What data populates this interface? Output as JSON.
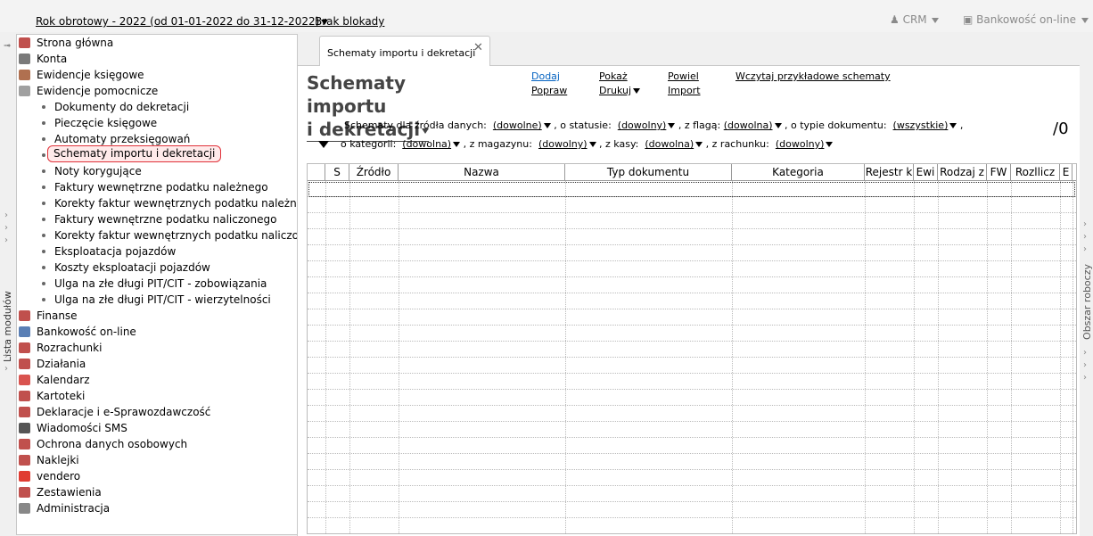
{
  "topbar": {
    "fiscal_year": "Rok obrotowy - 2022  (od 01-01-2022 do 31-12-2022)",
    "lock_status": "Brak blokady",
    "crm": "CRM",
    "online_banking": "Bankowość on-line"
  },
  "left_rail": {
    "label": "Lista modułów"
  },
  "right_rail": {
    "label": "Obszar roboczy"
  },
  "nav": {
    "items": [
      {
        "label": "Strona główna",
        "level": 0,
        "icon": "home-icon",
        "color": "#c0504d"
      },
      {
        "label": "Konta",
        "level": 0,
        "icon": "accounts-icon",
        "color": "#7a7a7a"
      },
      {
        "label": "Ewidencje księgowe",
        "level": 0,
        "icon": "ledger-icon",
        "color": "#b07050"
      },
      {
        "label": "Ewidencje pomocnicze",
        "level": 0,
        "icon": "auxiliary-ledger-icon",
        "color": "#a0a0a0"
      },
      {
        "label": "Dokumenty do dekretacji",
        "level": 1
      },
      {
        "label": "Pieczęcie księgowe",
        "level": 1
      },
      {
        "label": "Automaty przeksięgowań",
        "level": 1
      },
      {
        "label": "Schematy importu i dekretacji",
        "level": 1,
        "selected": true
      },
      {
        "label": "Noty korygujące",
        "level": 1
      },
      {
        "label": "Faktury wewnętrzne podatku należnego",
        "level": 1
      },
      {
        "label": "Korekty faktur wewnętrznych podatku należnego",
        "level": 1
      },
      {
        "label": "Faktury wewnętrzne podatku naliczonego",
        "level": 1
      },
      {
        "label": "Korekty faktur wewnętrznych podatku naliczonego",
        "level": 1
      },
      {
        "label": "Eksploatacja pojazdów",
        "level": 1
      },
      {
        "label": "Koszty eksploatacji pojazdów",
        "level": 1
      },
      {
        "label": "Ulga na złe długi PIT/CIT - zobowiązania",
        "level": 1
      },
      {
        "label": "Ulga na złe długi PIT/CIT - wierzytelności",
        "level": 1
      },
      {
        "label": "Finanse",
        "level": 0,
        "icon": "finance-icon",
        "color": "#c0504d"
      },
      {
        "label": "Bankowość on-line",
        "level": 0,
        "icon": "bank-icon",
        "color": "#5a7fb5"
      },
      {
        "label": "Rozrachunki",
        "level": 0,
        "icon": "settlements-icon",
        "color": "#c0504d"
      },
      {
        "label": "Działania",
        "level": 0,
        "icon": "actions-icon",
        "color": "#c0504d"
      },
      {
        "label": "Kalendarz",
        "level": 0,
        "icon": "calendar-icon",
        "color": "#d9534f"
      },
      {
        "label": "Kartoteki",
        "level": 0,
        "icon": "records-icon",
        "color": "#c0504d"
      },
      {
        "label": "Deklaracje i e-Sprawozdawczość",
        "level": 0,
        "icon": "declarations-icon",
        "color": "#c0504d"
      },
      {
        "label": "Wiadomości SMS",
        "level": 0,
        "icon": "sms-icon",
        "color": "#555555"
      },
      {
        "label": "Ochrona danych osobowych",
        "level": 0,
        "icon": "data-protection-icon",
        "color": "#c0504d"
      },
      {
        "label": "Naklejki",
        "level": 0,
        "icon": "stickers-icon",
        "color": "#c0504d"
      },
      {
        "label": "vendero",
        "level": 0,
        "icon": "vendero-icon",
        "color": "#e03c31"
      },
      {
        "label": "Zestawienia",
        "level": 0,
        "icon": "reports-icon",
        "color": "#c0504d"
      },
      {
        "label": "Administracja",
        "level": 0,
        "icon": "admin-icon",
        "color": "#888888"
      }
    ]
  },
  "main": {
    "tab_label": "Schematy importu i dekretacji",
    "title_line1": "Schematy importu",
    "title_line2": "i dekretacji",
    "actions": {
      "add": "Dodaj",
      "edit": "Popraw",
      "show": "Pokaż",
      "print": "Drukuj",
      "duplicate": "Powiel",
      "import": "Import",
      "load_examples": "Wczytaj przykładowe schematy"
    },
    "filters": {
      "source_label": "Schematy dla źródła danych:",
      "source_value": "(dowolne)",
      "status_label": ", o statusie:",
      "status_value": "(dowolny)",
      "flag_label": ", z flagą:",
      "flag_value": "(dowolna)",
      "doctype_label": ", o typie dokumentu:",
      "doctype_value": "(wszystkie)",
      "category_label": "o kategorii:",
      "category_value": "(dowolna)",
      "warehouse_label": ", z magazynu:",
      "warehouse_value": "(dowolny)",
      "cashbox_label": ", z kasy:",
      "cashbox_value": "(dowolna)",
      "account_label": ", z rachunku:",
      "account_value": "(dowolny)"
    },
    "count": "/0",
    "columns": [
      "S",
      "Źródło",
      "Nazwa",
      "Typ dokumentu",
      "Kategoria",
      "Rejestr k",
      "Ewi",
      "Rodzaj z",
      "FW",
      "Rozllicz",
      "E"
    ]
  }
}
